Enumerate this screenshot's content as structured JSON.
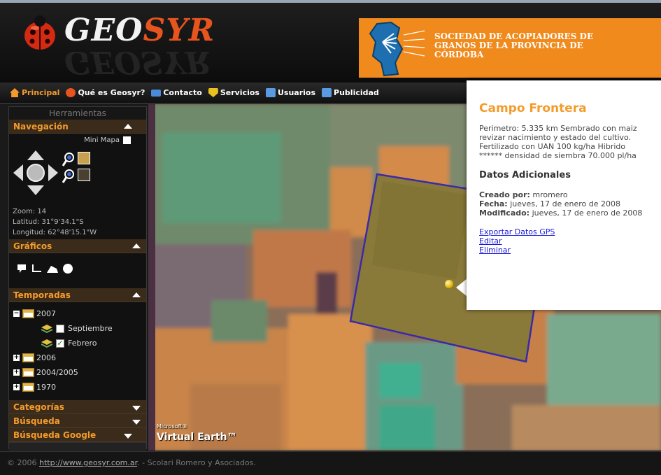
{
  "header": {
    "logo_geo": "GEO",
    "logo_syr": "SYR",
    "banner_lines": [
      "SOCIEDAD DE ACOPIADORES DE",
      "GRANOS DE LA PROVINCIA DE",
      "CÓRDOBA"
    ]
  },
  "nav": {
    "items": [
      {
        "label": "Principal",
        "icon": "home-icon",
        "color": "#f49b2a"
      },
      {
        "label": "Qué es Geosyr?",
        "icon": "ladybug-icon",
        "color": "#e8541e"
      },
      {
        "label": "Contacto",
        "icon": "mail-icon",
        "color": "#4a8ad8"
      },
      {
        "label": "Servicios",
        "icon": "shield-icon",
        "color": "#e8c020"
      },
      {
        "label": "Usuarios",
        "icon": "users-icon",
        "color": "#5a9ae0"
      },
      {
        "label": "Publicidad",
        "icon": "ad-icon",
        "color": "#5a9ae0"
      }
    ]
  },
  "sidebar": {
    "title": "Herramientas",
    "navegacion": {
      "label": "Navegación",
      "mini_mapa": "Mini Mapa",
      "zoom": "Zoom: 14",
      "latitud": "Latitud: 31°9'34.1\"S",
      "longitud": "Longitud: 62°48'15.1\"W"
    },
    "graficos": {
      "label": "Gráficos"
    },
    "temporadas": {
      "label": "Temporadas",
      "years": [
        {
          "label": "2007",
          "expanded": true,
          "children": [
            {
              "label": "Septiembre",
              "checked": false
            },
            {
              "label": "Febrero",
              "checked": true
            }
          ]
        },
        {
          "label": "2006",
          "expanded": false
        },
        {
          "label": "2004/2005",
          "expanded": false
        },
        {
          "label": "1970",
          "expanded": false
        }
      ]
    },
    "categorias": {
      "label": "Categorías"
    },
    "busqueda": {
      "label": "Búsqueda"
    },
    "busqueda_google": {
      "label": "Búsqueda Google"
    }
  },
  "map": {
    "ve_small": "Microsoft®",
    "ve_big": "Virtual Earth™"
  },
  "popup": {
    "title": "Campo Frontera",
    "description": "Perimetro: 5.335 km Sembrado con maiz revizar nacimiento y estado del cultivo. Fertilizado con UAN 100 kg/ha Hibrido ****** densidad de siembra 70.000 pl/ha",
    "extra_title": "Datos Adicionales",
    "creado_label": "Creado por:",
    "creado_value": " mromero",
    "fecha_label": "Fecha:",
    "fecha_value": " jueves, 17 de enero de 2008",
    "modificado_label": "Modificado:",
    "modificado_value": " jueves, 17 de enero de 2008",
    "links": [
      "Exportar Datos GPS",
      "Editar",
      "Eliminar"
    ]
  },
  "footer": {
    "prefix": "© 2006 ",
    "link": "http://www.geosyr.com.ar",
    "suffix": ". - Scolari Romero y Asociados."
  }
}
